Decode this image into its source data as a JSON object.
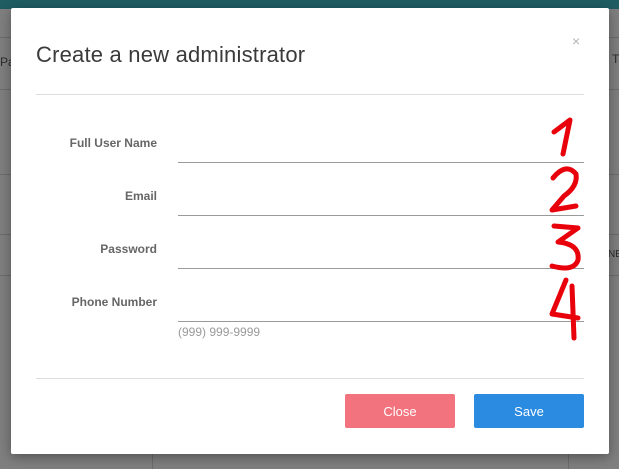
{
  "background": {
    "left_text_1": "Pa",
    "right_text_1": "T",
    "right_text_2": "NE"
  },
  "modal": {
    "title": "Create a new administrator",
    "close_glyph": "×",
    "fields": [
      {
        "label": "Full User Name",
        "value": ""
      },
      {
        "label": "Email",
        "value": ""
      },
      {
        "label": "Password",
        "value": ""
      },
      {
        "label": "Phone Number",
        "value": ""
      }
    ],
    "phone_hint": "(999) 999-9999",
    "buttons": {
      "close_label": "Close",
      "save_label": "Save"
    }
  },
  "annotations": {
    "numbers": [
      "1",
      "2",
      "3",
      "4"
    ],
    "color": "#e8000a"
  },
  "colors": {
    "header_bar": "#1e5d62",
    "close_button": "#f2737e",
    "save_button": "#2a8be1"
  }
}
